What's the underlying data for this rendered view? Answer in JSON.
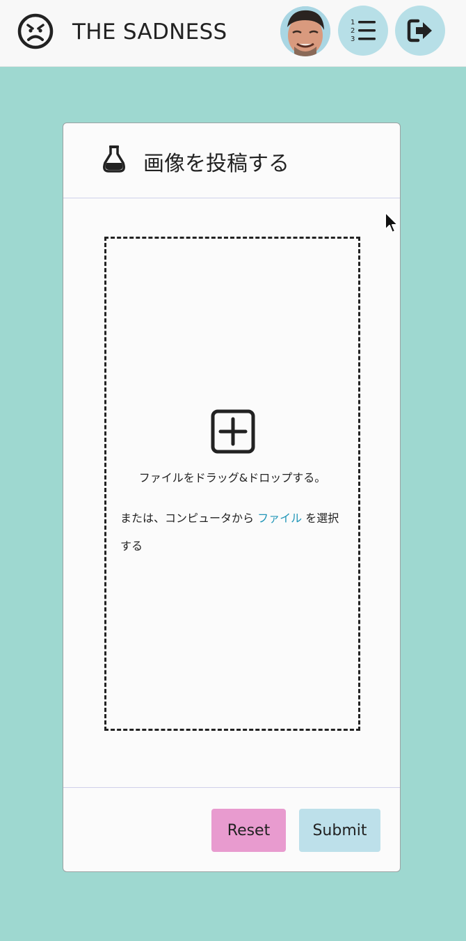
{
  "header": {
    "logo_icon": "sad-face-icon",
    "title": "THE SADNESS",
    "avatar_icon": "user-avatar",
    "list_icon": "numbered-list-icon",
    "logout_icon": "sign-out-icon"
  },
  "card": {
    "header_icon": "flask-icon",
    "title": "画像を投稿する",
    "dropzone": {
      "icon": "plus-square-icon",
      "drag_text": "ファイルをドラッグ&ドロップする。",
      "or_text_prefix": "または、コンピュータから",
      "file_link": "ファイル",
      "or_text_suffix": "を選択する"
    },
    "buttons": {
      "reset": "Reset",
      "submit": "Submit"
    }
  },
  "colors": {
    "page_background": "#9ed8d0",
    "reset_button": "#e89bcf",
    "submit_button": "#bde0ea",
    "link": "#2196b8"
  }
}
